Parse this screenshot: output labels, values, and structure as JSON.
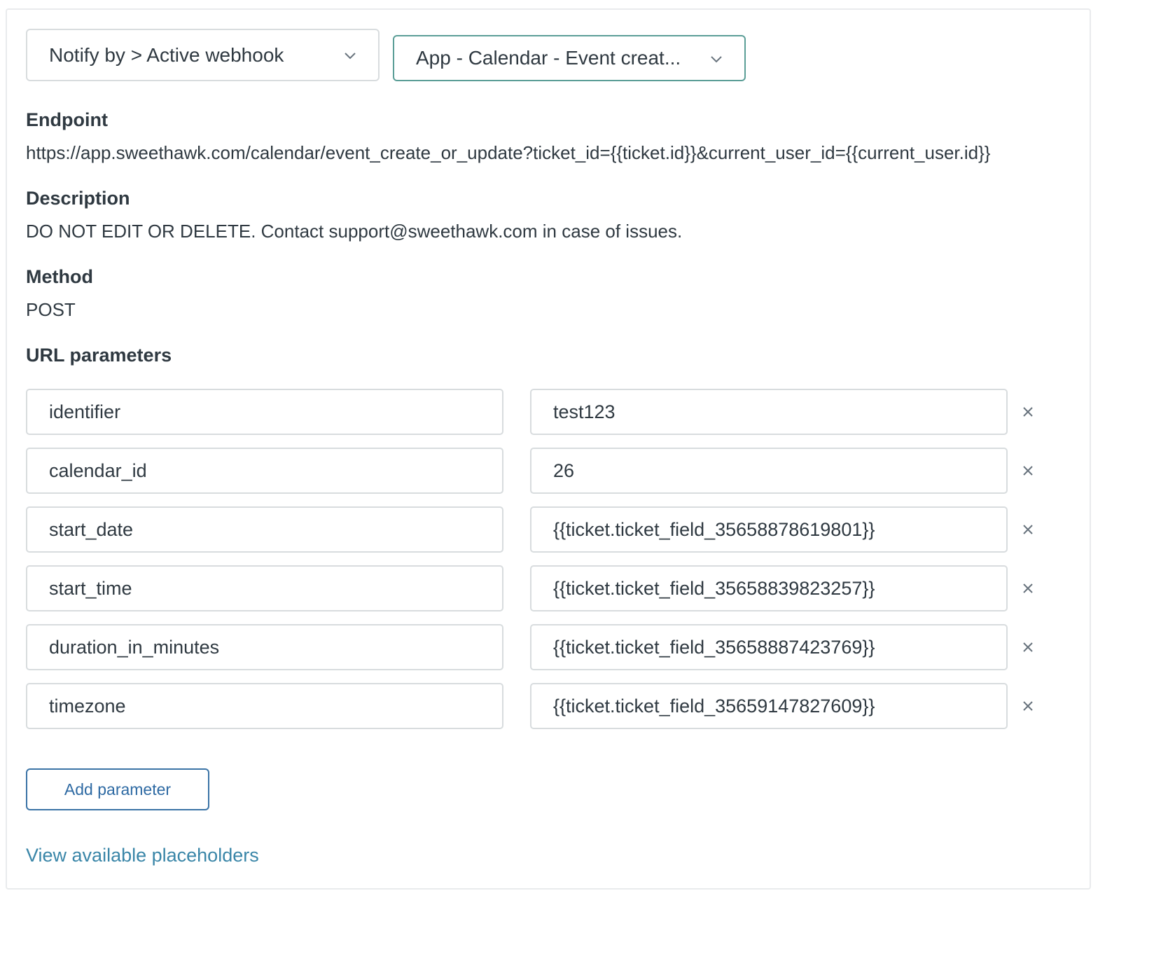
{
  "selects": {
    "notify": "Notify by > Active webhook",
    "webhook": "App - Calendar - Event creat..."
  },
  "endpoint": {
    "label": "Endpoint",
    "value": "https://app.sweethawk.com/calendar/event_create_or_update?ticket_id={{ticket.id}}&current_user_id={{current_user.id}}"
  },
  "description": {
    "label": "Description",
    "value": "DO NOT EDIT OR DELETE. Contact support@sweethawk.com in case of issues."
  },
  "method": {
    "label": "Method",
    "value": "POST"
  },
  "url_parameters": {
    "label": "URL parameters",
    "rows": [
      {
        "key": "identifier",
        "value": "test123"
      },
      {
        "key": "calendar_id",
        "value": "26"
      },
      {
        "key": "start_date",
        "value": "{{ticket.ticket_field_35658878619801}}"
      },
      {
        "key": "start_time",
        "value": "{{ticket.ticket_field_35658839823257}}"
      },
      {
        "key": "duration_in_minutes",
        "value": "{{ticket.ticket_field_35658887423769}}"
      },
      {
        "key": "timezone",
        "value": "{{ticket.ticket_field_35659147827609}}"
      }
    ],
    "remove_icon": "close-icon"
  },
  "actions": {
    "add_parameter": "Add parameter",
    "view_placeholders": "View available placeholders"
  },
  "colors": {
    "accent_border": "#5b9e97",
    "button_blue": "#2e6aa3",
    "link_blue": "#3a86a8",
    "input_border": "#d8dcde"
  }
}
